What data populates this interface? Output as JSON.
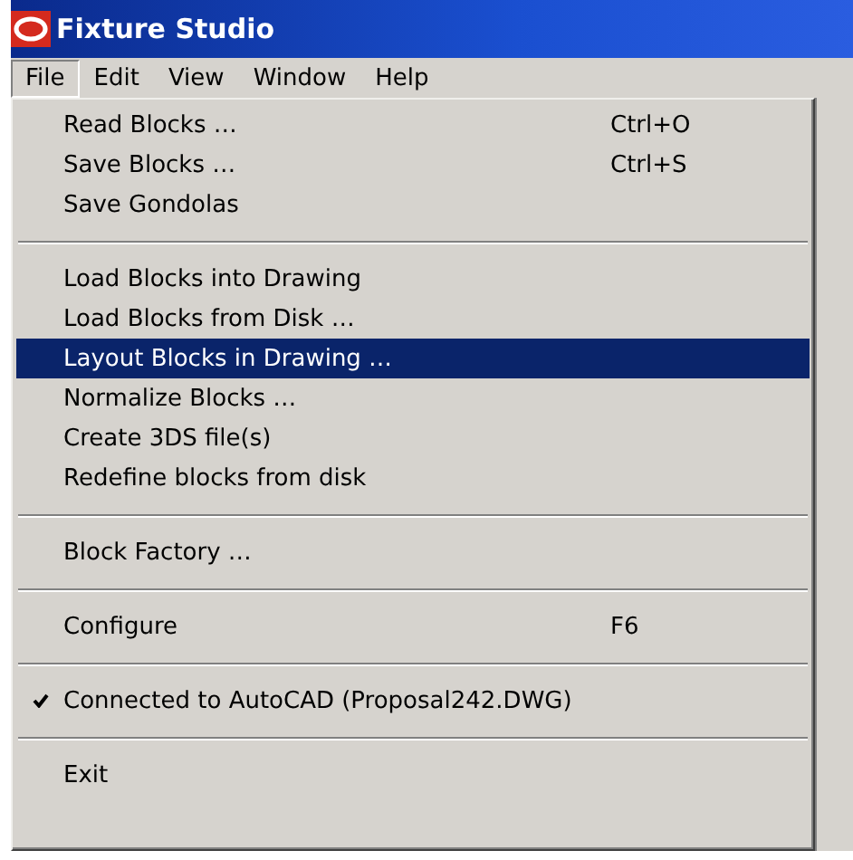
{
  "window": {
    "title": "Fixture Studio"
  },
  "menubar": [
    {
      "label": "File",
      "selected": true
    },
    {
      "label": "Edit",
      "selected": false
    },
    {
      "label": "View",
      "selected": false
    },
    {
      "label": "Window",
      "selected": false
    },
    {
      "label": "Help",
      "selected": false
    }
  ],
  "menu": [
    {
      "kind": "item",
      "label": "Read Blocks …",
      "shortcut": "Ctrl+O",
      "selected": false,
      "checked": false
    },
    {
      "kind": "item",
      "label": "Save Blocks …",
      "shortcut": "Ctrl+S",
      "selected": false,
      "checked": false
    },
    {
      "kind": "item",
      "label": "Save Gondolas",
      "selected": false,
      "checked": false
    },
    {
      "kind": "separator"
    },
    {
      "kind": "item",
      "label": "Load Blocks into Drawing",
      "selected": false,
      "checked": false
    },
    {
      "kind": "item",
      "label": "Load Blocks from Disk …",
      "selected": false,
      "checked": false
    },
    {
      "kind": "item",
      "label": "Layout Blocks in Drawing …",
      "selected": true,
      "checked": false
    },
    {
      "kind": "item",
      "label": "Normalize Blocks …",
      "selected": false,
      "checked": false
    },
    {
      "kind": "item",
      "label": "Create 3DS file(s)",
      "selected": false,
      "checked": false
    },
    {
      "kind": "item",
      "label": "Redefine blocks from disk",
      "selected": false,
      "checked": false
    },
    {
      "kind": "separator"
    },
    {
      "kind": "item",
      "label": "Block Factory …",
      "selected": false,
      "checked": false
    },
    {
      "kind": "separator"
    },
    {
      "kind": "item",
      "label": "Configure",
      "shortcut": "F6",
      "selected": false,
      "checked": false
    },
    {
      "kind": "separator"
    },
    {
      "kind": "item",
      "label": "Connected to AutoCAD (Proposal242.DWG)",
      "selected": false,
      "checked": true
    },
    {
      "kind": "separator"
    },
    {
      "kind": "item",
      "label": "Exit",
      "selected": false,
      "checked": false
    }
  ]
}
